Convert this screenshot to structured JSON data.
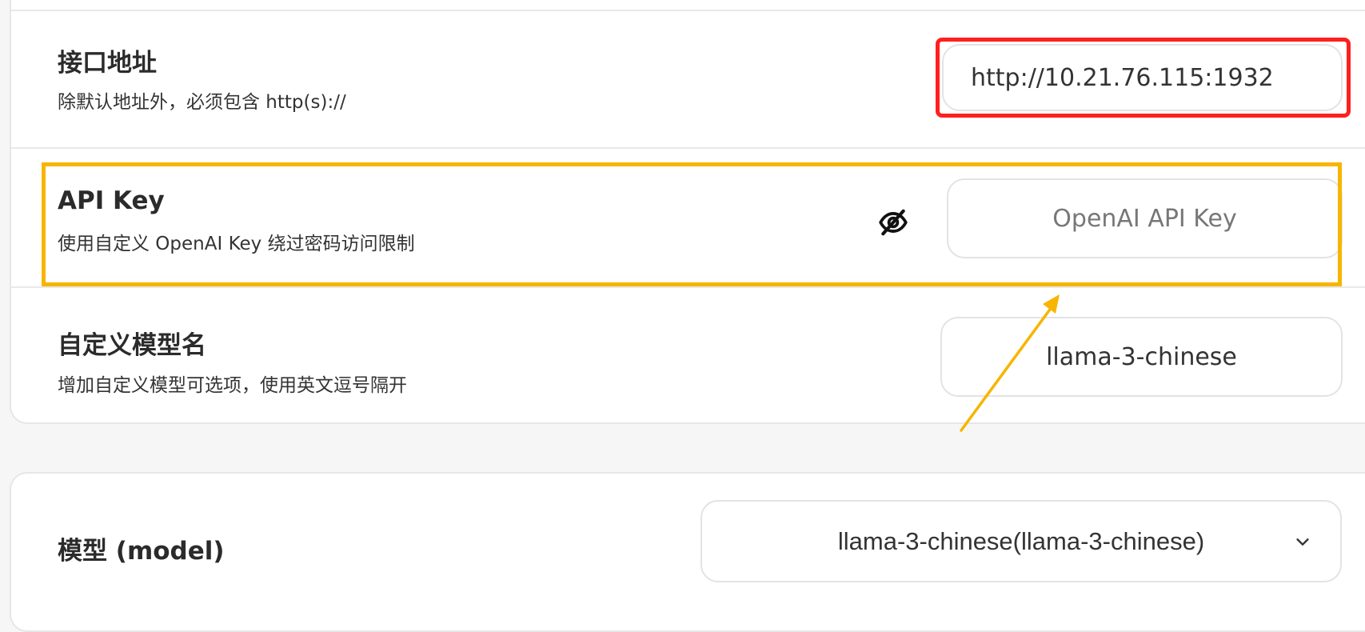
{
  "settings": {
    "endpoint": {
      "title": "接口地址",
      "description": "除默认地址外，必须包含 http(s)://",
      "value": "http://10.21.76.115:1932"
    },
    "api_key": {
      "title": "API Key",
      "description": "使用自定义 OpenAI Key 绕过密码访问限制",
      "placeholder": "OpenAI API Key"
    },
    "custom_models": {
      "title": "自定义模型名",
      "description": "增加自定义模型可选项，使用英文逗号隔开",
      "value": "llama-3-chinese"
    }
  },
  "model": {
    "label": "模型 (model)",
    "selected": "llama-3-chinese(llama-3-chinese)"
  },
  "icons": {
    "eye": "eye-off-icon",
    "dropdown": "chevron-down-icon"
  },
  "colors": {
    "highlight_red": "#ff1f1f",
    "highlight_yellow": "#f7b500",
    "arrow": "#f7b500"
  }
}
